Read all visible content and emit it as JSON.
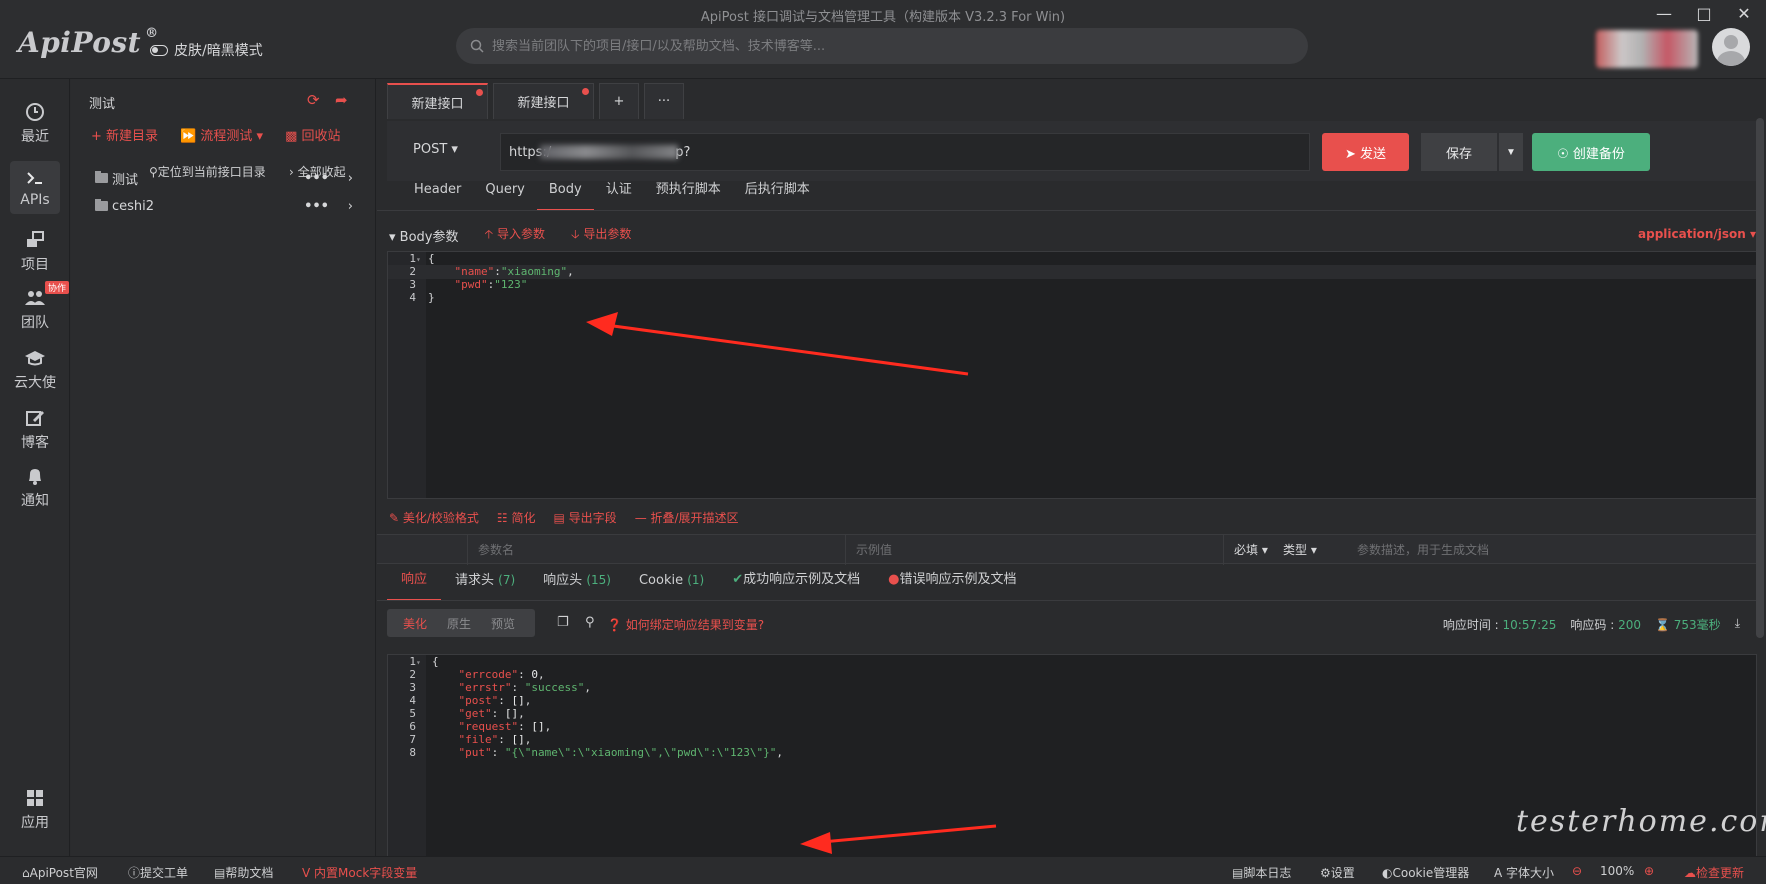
{
  "window": {
    "title": "ApiPost 接口调试与文档管理工具（构建版本 V3.2.3 For Win)",
    "logo": "ApiPost",
    "logo_mark": "®",
    "theme_toggle": "皮肤/暗黑模式",
    "search_placeholder": "搜索当前团队下的项目/接口/以及帮助文档、技术博客等..."
  },
  "nav": {
    "items": [
      {
        "label": "最近"
      },
      {
        "label": "APIs"
      },
      {
        "label": "项目"
      },
      {
        "label": "团队",
        "badge": "协作"
      },
      {
        "label": "云大使"
      },
      {
        "label": "博客"
      },
      {
        "label": "通知"
      },
      {
        "label": "应用"
      }
    ]
  },
  "sidebar": {
    "project": "测试",
    "new_dir": "新建目录",
    "flow_test": "流程测试",
    "recycle": "回收站",
    "locate": "定位到当前接口目录",
    "collapse_all": "全部收起",
    "folders": [
      {
        "name": "测试"
      },
      {
        "name": "ceshi2"
      }
    ]
  },
  "tabs": [
    {
      "label": "新建接口"
    },
    {
      "label": "新建接口"
    }
  ],
  "request": {
    "method": "POST",
    "url": "https:/                              p?",
    "send": "发送",
    "save": "保存",
    "backup": "创建备份",
    "tabs": [
      "Header",
      "Query",
      "Body",
      "认证",
      "预执行脚本",
      "后执行脚本"
    ],
    "body_params": "Body参数",
    "import_params": "导入参数",
    "export_params": "导出参数",
    "content_type": "application/json",
    "body_lines": [
      {
        "no": "1",
        "text": "{"
      },
      {
        "no": "2",
        "key": "\"name\"",
        "value": "\"xiaoming\"",
        "trail": ","
      },
      {
        "no": "3",
        "key": "\"pwd\"",
        "value": "\"123\"",
        "trail": ""
      },
      {
        "no": "4",
        "text": "}"
      }
    ],
    "tools": [
      "美化/校验格式",
      "简化",
      "导出字段",
      "折叠/展开描述区"
    ],
    "param_columns": {
      "name": "参数名",
      "example": "示例值",
      "required": "必填",
      "type": "类型",
      "desc": "参数描述，用于生成文档"
    }
  },
  "response": {
    "tabs": [
      {
        "label": "响应",
        "count": ""
      },
      {
        "label": "请求头",
        "count": "(7)"
      },
      {
        "label": "响应头",
        "count": "(15)"
      },
      {
        "label": "Cookie",
        "count": "(1)"
      },
      {
        "label": "成功响应示例及文档",
        "count": ""
      },
      {
        "label": "错误响应示例及文档",
        "count": ""
      }
    ],
    "view_modes": [
      "美化",
      "原生",
      "预览"
    ],
    "bind_help": "如何绑定响应结果到变量?",
    "time_label": "响应时间 :",
    "time_value": "10:57:25",
    "code_label": "响应码 :",
    "code_value": "200",
    "duration": "753毫秒",
    "lines": [
      {
        "no": "1",
        "text": "{"
      },
      {
        "no": "2",
        "key": "\"errcode\"",
        "value": "0",
        "trail": ",",
        "num": true
      },
      {
        "no": "3",
        "key": "\"errstr\"",
        "value": "\"success\"",
        "trail": ","
      },
      {
        "no": "4",
        "key": "\"post\"",
        "value": "[]",
        "trail": ",",
        "num": true
      },
      {
        "no": "5",
        "key": "\"get\"",
        "value": "[]",
        "trail": ",",
        "num": true
      },
      {
        "no": "6",
        "key": "\"request\"",
        "value": "[]",
        "trail": ",",
        "num": true
      },
      {
        "no": "7",
        "key": "\"file\"",
        "value": "[]",
        "trail": ",",
        "num": true
      },
      {
        "no": "8",
        "key": "\"put\"",
        "value": "\"{\\\"name\\\":\\\"xiaoming\\\",\\\"pwd\\\":\\\"123\\\"}\"",
        "trail": ","
      }
    ]
  },
  "statusbar": {
    "official": "ApiPost官网",
    "ticket": "提交工单",
    "help": "帮助文档",
    "mock": "内置Mock字段变量",
    "script_log": "脚本日志",
    "settings": "设置",
    "cookie_mgr": "Cookie管理器",
    "font_size": "字体大小",
    "zoom": "100%",
    "check_update": "检查更新"
  },
  "watermark": "testerhome.com",
  "colors": {
    "accent": "#e8504d",
    "success": "#4caf7d",
    "background": "#2a2b2d"
  }
}
